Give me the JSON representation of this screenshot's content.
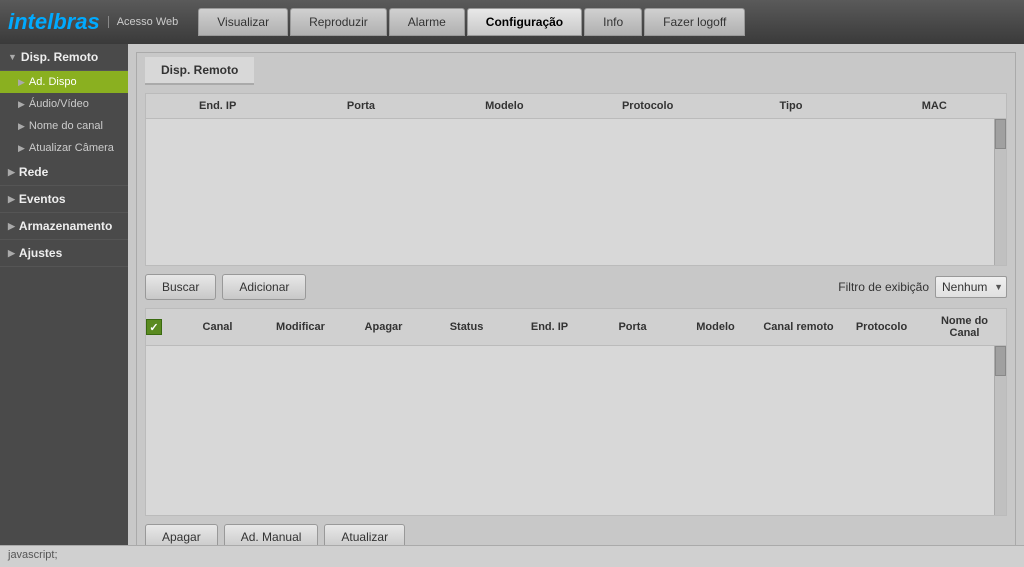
{
  "header": {
    "logo_brand": "intelbras",
    "separator": "|",
    "acesso_web": "Acesso Web",
    "nav_tabs": [
      {
        "label": "Visualizar",
        "active": false
      },
      {
        "label": "Reproduzir",
        "active": false
      },
      {
        "label": "Alarme",
        "active": false
      },
      {
        "label": "Configuração",
        "active": true
      },
      {
        "label": "Info",
        "active": false
      },
      {
        "label": "Fazer logoff",
        "active": false
      }
    ]
  },
  "sidebar": {
    "sections": [
      {
        "label": "Disp. Remoto",
        "expanded": true,
        "items": [
          {
            "label": "Ad. Dispo",
            "active": true
          },
          {
            "label": "Áudio/Vídeo",
            "active": false
          },
          {
            "label": "Nome do canal",
            "active": false
          },
          {
            "label": "Atualizar Câmera",
            "active": false
          }
        ]
      },
      {
        "label": "Rede",
        "expanded": false,
        "items": []
      },
      {
        "label": "Eventos",
        "expanded": false,
        "items": []
      },
      {
        "label": "Armazenamento",
        "expanded": false,
        "items": []
      },
      {
        "label": "Ajustes",
        "expanded": false,
        "items": []
      }
    ]
  },
  "panel": {
    "tab_label": "Disp. Remoto",
    "table1": {
      "columns": [
        "End. IP",
        "Porta",
        "Modelo",
        "Protocolo",
        "Tipo",
        "MAC"
      ]
    },
    "buttons": {
      "buscar": "Buscar",
      "adicionar": "Adicionar",
      "filter_label": "Filtro de exibição",
      "filter_value": "Nenhum"
    },
    "table2": {
      "columns": [
        "Canal",
        "Modificar",
        "Apagar",
        "Status",
        "End. IP",
        "Porta",
        "Modelo",
        "Canal remoto",
        "Protocolo",
        "Nome do Canal"
      ]
    },
    "bottom_buttons": {
      "apagar": "Apagar",
      "ad_manual": "Ad. Manual",
      "atualizar": "Atualizar"
    }
  },
  "status_bar": {
    "text": "javascript;"
  }
}
